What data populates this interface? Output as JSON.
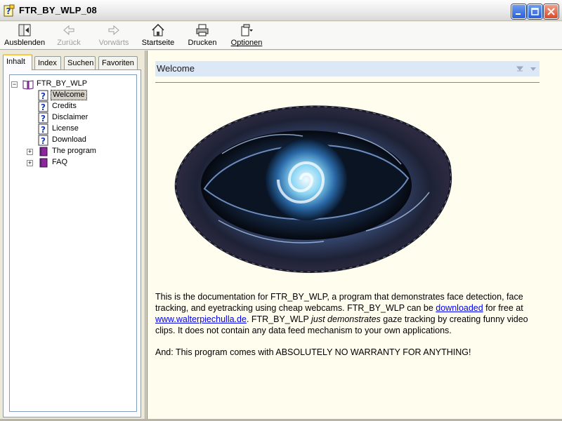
{
  "window": {
    "title": "FTR_BY_WLP_08",
    "minimize_icon": "minimize-icon",
    "maximize_icon": "maximize-icon",
    "close_icon": "close-icon"
  },
  "toolbar": {
    "hide_label": "Ausblenden",
    "back_label": "Zurück",
    "forward_label": "Vorwärts",
    "home_label": "Startseite",
    "print_label": "Drucken",
    "options_label": "Optionen"
  },
  "tabs": {
    "contents": "Inhalt",
    "index": "Index",
    "search": "Suchen",
    "favorites": "Favoriten"
  },
  "tree": {
    "root": "FTR_BY_WLP",
    "items": [
      "Welcome",
      "Credits",
      "Disclaimer",
      "License",
      "Download"
    ],
    "books": [
      "The program",
      "FAQ"
    ]
  },
  "content": {
    "heading": "Welcome",
    "p1_a": "This is the documentation for FTR_BY_WLP, a program that demonstrates face detection, face tracking, and eyetracking using cheap webcams. FTR_BY_WLP can be ",
    "p1_link1": "downloaded",
    "p1_b": " for free at ",
    "p1_link2": "www.walterpiechulla.de",
    "p1_c": ". FTR_BY_WLP ",
    "p1_em": "just demonstrates",
    "p1_d": " gaze tracking by creating funny video clips. It does not contain any data feed mechanism to your own applications.",
    "p2": "And: This program comes with ABSOLUTELY NO WARRANTY FOR ANYTHING!"
  },
  "colors": {
    "content_bg": "#fffdee",
    "header_bg": "#dde8f6",
    "link": "#0000ee"
  }
}
